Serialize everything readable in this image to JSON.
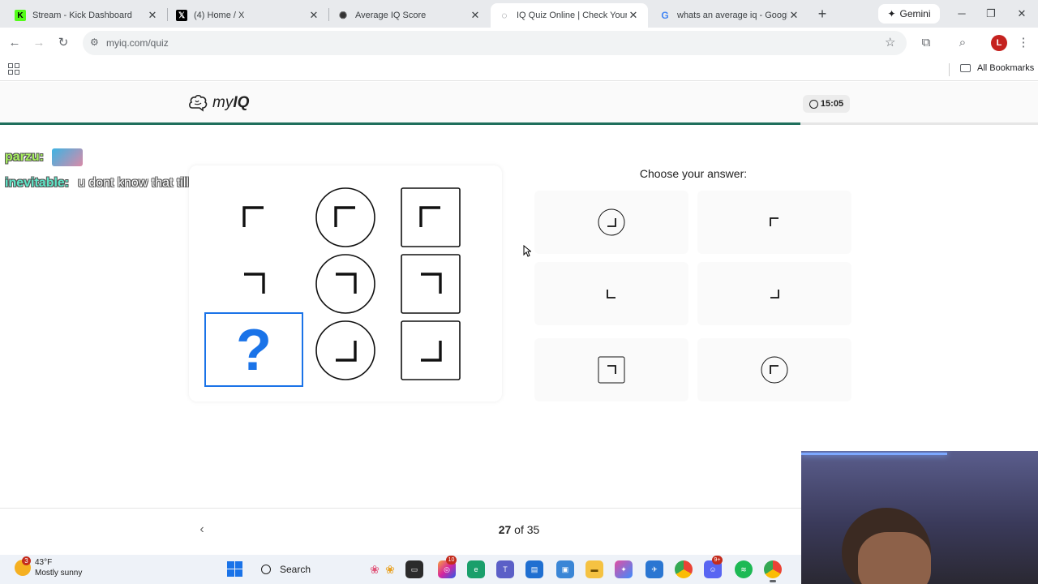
{
  "browser": {
    "tabs": [
      {
        "title": "Stream - Kick Dashboard",
        "icon": "kick-logo-icon",
        "active": false
      },
      {
        "title": "(4) Home / X",
        "icon": "x-logo-icon",
        "active": false
      },
      {
        "title": "Average IQ Score",
        "icon": "openai-logo-icon",
        "active": false
      },
      {
        "title": "IQ Quiz Online | Check Your IQ",
        "icon": "chat-bubble-icon",
        "active": true
      },
      {
        "title": "whats an average iq - Google S",
        "icon": "google-logo-icon",
        "active": false
      }
    ],
    "gemini_label": "Gemini",
    "url": "myiq.com/quiz",
    "profile_initial": "L",
    "bookmarks_label": "All Bookmarks"
  },
  "site": {
    "logo_my": "my",
    "logo_iq": "IQ",
    "timer": "15:05",
    "progress_fraction": 0.771
  },
  "chat": [
    {
      "user": "parzu:",
      "message": "",
      "has_emote": true
    },
    {
      "user": "inevitable:",
      "message": "u dont know that till the test end"
    }
  ],
  "puzzle": {
    "question_mark": "?",
    "cells": [
      {
        "row": 0,
        "col": 0,
        "frame": "none",
        "corner": "top-left"
      },
      {
        "row": 0,
        "col": 1,
        "frame": "circle",
        "corner": "top-left"
      },
      {
        "row": 0,
        "col": 2,
        "frame": "square",
        "corner": "top-left"
      },
      {
        "row": 1,
        "col": 0,
        "frame": "none",
        "corner": "top-right"
      },
      {
        "row": 1,
        "col": 1,
        "frame": "circle",
        "corner": "top-right"
      },
      {
        "row": 1,
        "col": 2,
        "frame": "square",
        "corner": "top-right"
      },
      {
        "row": 2,
        "col": 0,
        "frame": "missing",
        "corner": "unknown"
      },
      {
        "row": 2,
        "col": 1,
        "frame": "circle",
        "corner": "bottom-right"
      },
      {
        "row": 2,
        "col": 2,
        "frame": "square",
        "corner": "bottom-right"
      }
    ]
  },
  "answers": {
    "prompt": "Choose your answer:",
    "options": [
      {
        "frame": "circle",
        "corner": "bottom-right"
      },
      {
        "frame": "none",
        "corner": "top-left"
      },
      {
        "frame": "none",
        "corner": "bottom-left"
      },
      {
        "frame": "none",
        "corner": "bottom-right"
      },
      {
        "frame": "square",
        "corner": "top-right"
      },
      {
        "frame": "circle",
        "corner": "top-left"
      }
    ]
  },
  "navigation": {
    "current": "27",
    "of_label": "of",
    "total": "35"
  },
  "taskbar": {
    "weather_temp": "43°F",
    "weather_desc": "Mostly sunny",
    "weather_badge": "3",
    "search_label": "Search",
    "instagram_badge": "10",
    "discord_badge": "9+"
  }
}
